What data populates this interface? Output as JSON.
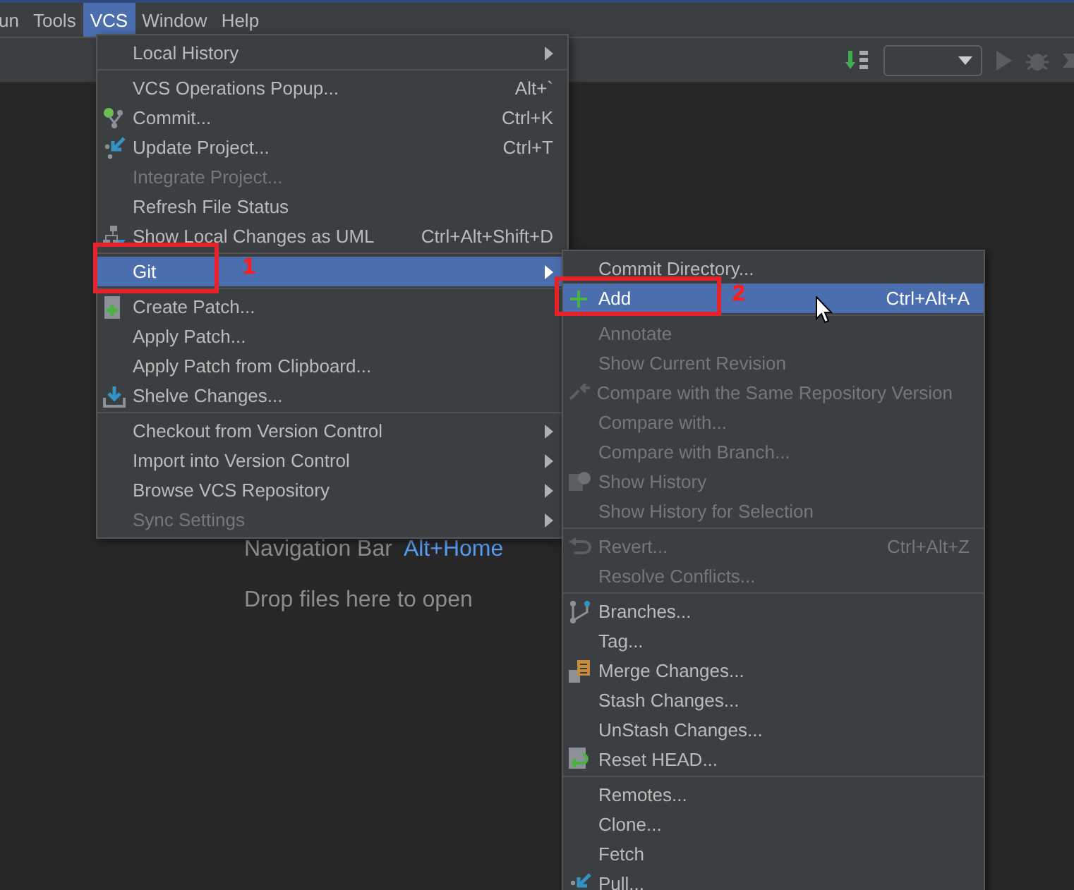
{
  "menubar": [
    {
      "label": "un",
      "selected": false
    },
    {
      "label": "Tools",
      "selected": false
    },
    {
      "label": "VCS",
      "selected": true
    },
    {
      "label": "Window",
      "selected": false
    },
    {
      "label": "Help",
      "selected": false
    }
  ],
  "annotations": [
    {
      "label": "1"
    },
    {
      "label": "2"
    }
  ],
  "editor": {
    "hints": [
      {
        "label": "Navigation Bar",
        "shortcut": "Alt+Home"
      },
      {
        "label": "Drop files here to open"
      }
    ]
  },
  "vcs_menu": {
    "groups": [
      [
        {
          "label": "Local History",
          "submenu": true,
          "disabled": false,
          "selected": false
        }
      ],
      [
        {
          "label": "VCS Operations Popup...",
          "shortcut": "Alt+`",
          "disabled": false,
          "selected": false
        },
        {
          "label": "Commit...",
          "shortcut": "Ctrl+K",
          "kind": "commit",
          "disabled": false,
          "selected": false
        },
        {
          "label": "Update Project...",
          "shortcut": "Ctrl+T",
          "kind": "update",
          "disabled": false,
          "selected": false
        },
        {
          "label": "Integrate Project...",
          "disabled": true,
          "selected": false
        },
        {
          "label": "Refresh File Status",
          "disabled": false,
          "selected": false
        },
        {
          "label": "Show Local Changes as UML",
          "shortcut": "Ctrl+Alt+Shift+D",
          "kind": "uml",
          "disabled": false,
          "selected": false
        }
      ],
      [
        {
          "label": "Git",
          "submenu": true,
          "disabled": false,
          "selected": true
        }
      ],
      [
        {
          "label": "Create Patch...",
          "kind": "patch",
          "disabled": false,
          "selected": false
        },
        {
          "label": "Apply Patch...",
          "disabled": false,
          "selected": false
        },
        {
          "label": "Apply Patch from Clipboard...",
          "disabled": false,
          "selected": false
        },
        {
          "label": "Shelve Changes...",
          "kind": "shelve",
          "disabled": false,
          "selected": false
        }
      ],
      [
        {
          "label": "Checkout from Version Control",
          "submenu": true,
          "disabled": false,
          "selected": false
        },
        {
          "label": "Import into Version Control",
          "submenu": true,
          "disabled": false,
          "selected": false
        },
        {
          "label": "Browse VCS Repository",
          "submenu": true,
          "disabled": false,
          "selected": false
        },
        {
          "label": "Sync Settings",
          "submenu": true,
          "disabled": true,
          "selected": false
        }
      ]
    ]
  },
  "git_menu": {
    "groups": [
      [
        {
          "label": "Commit Directory...",
          "disabled": false,
          "selected": false
        },
        {
          "label": "Add",
          "shortcut": "Ctrl+Alt+A",
          "kind": "add",
          "disabled": false,
          "selected": true
        }
      ],
      [
        {
          "label": "Annotate",
          "disabled": true,
          "selected": false
        },
        {
          "label": "Show Current Revision",
          "disabled": true,
          "selected": false
        },
        {
          "label": "Compare with the Same Repository Version",
          "kind": "compare",
          "disabled": true,
          "selected": false
        },
        {
          "label": "Compare with...",
          "disabled": true,
          "selected": false
        },
        {
          "label": "Compare with Branch...",
          "disabled": true,
          "selected": false
        },
        {
          "label": "Show History",
          "kind": "history",
          "disabled": true,
          "selected": false
        },
        {
          "label": "Show History for Selection",
          "disabled": true,
          "selected": false
        }
      ],
      [
        {
          "label": "Revert...",
          "shortcut": "Ctrl+Alt+Z",
          "kind": "revert",
          "disabled": true,
          "selected": false
        },
        {
          "label": "Resolve Conflicts...",
          "disabled": true,
          "selected": false
        }
      ],
      [
        {
          "label": "Branches...",
          "kind": "branches",
          "disabled": false,
          "selected": false
        },
        {
          "label": "Tag...",
          "disabled": false,
          "selected": false
        },
        {
          "label": "Merge Changes...",
          "kind": "merge",
          "disabled": false,
          "selected": false
        },
        {
          "label": "Stash Changes...",
          "disabled": false,
          "selected": false
        },
        {
          "label": "UnStash Changes...",
          "disabled": false,
          "selected": false
        },
        {
          "label": "Reset HEAD...",
          "kind": "reset",
          "disabled": false,
          "selected": false
        }
      ],
      [
        {
          "label": "Remotes...",
          "disabled": false,
          "selected": false
        },
        {
          "label": "Clone...",
          "disabled": false,
          "selected": false
        },
        {
          "label": "Fetch",
          "disabled": false,
          "selected": false
        },
        {
          "label": "Pull...",
          "kind": "pull",
          "disabled": false,
          "selected": false
        }
      ]
    ]
  }
}
